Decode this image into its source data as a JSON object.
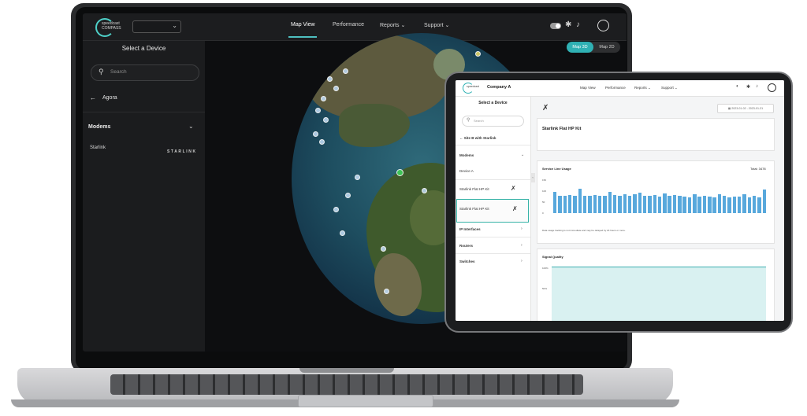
{
  "laptop": {
    "brand_line1": "speedcast",
    "brand_line2": "COMPASS",
    "nav": [
      "Map View",
      "Performance",
      "Reports",
      "Support"
    ],
    "side_title": "Select a Device",
    "search_placeholder": "Search",
    "back_label": "Agora",
    "section": "Modems",
    "device": "Starlink",
    "device_logo": "STARLINK",
    "view_toggle": {
      "on": "Map 3D",
      "off": "Map 2D"
    }
  },
  "tablet": {
    "company": "Company A",
    "nav": [
      "Map View",
      "Performance",
      "Reports",
      "Support"
    ],
    "side_title": "Select a Device",
    "search_placeholder": "Search",
    "back_label": "Site B with Starlink",
    "sections": [
      "Modems",
      "IP Interfaces",
      "Routers",
      "Switches"
    ],
    "devices": [
      "Device A",
      "Starlink Flat HP Kit",
      "Starlink Flat HP Kit"
    ],
    "date_range": "2023-01-02 - 2023-01-31",
    "device_title": "Starlink Flat HP Kit",
    "usage_title": "Service Line Usage",
    "usage_total": "Total: 3478",
    "usage_note": "Data usage tracking is not immediate and may be delayed by 24 hours or more.",
    "usage_y_labels": [
      "150",
      "100",
      "50",
      "0"
    ],
    "signal_title": "Signal Quality",
    "signal_y_labels": [
      "100%",
      "50%"
    ]
  },
  "chart_data": {
    "type": "bar",
    "values": [
      95,
      80,
      78,
      82,
      78,
      112,
      80,
      78,
      82,
      78,
      80,
      98,
      82,
      78,
      86,
      78,
      84,
      92,
      80,
      78,
      82,
      76,
      90,
      78,
      82,
      78,
      76,
      70,
      84,
      76,
      78,
      76,
      70,
      86,
      78,
      72,
      76,
      74,
      84,
      70,
      78,
      72,
      108
    ],
    "ylim": [
      0,
      150
    ]
  }
}
